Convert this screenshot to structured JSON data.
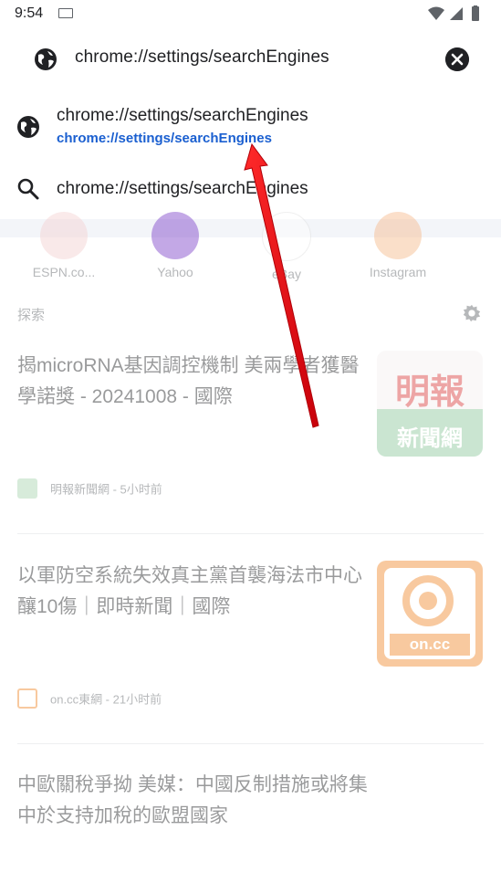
{
  "status_bar": {
    "time": "9:54"
  },
  "omnibox": {
    "text": "chrome://settings/searchEngines"
  },
  "suggestions": [
    {
      "title": "chrome://settings/searchEngines",
      "url": "chrome://settings/searchEngines",
      "icon": "globe-icon"
    },
    {
      "title": "chrome://settings/searchEngines",
      "icon": "search-icon"
    }
  ],
  "tiles": [
    {
      "label": "ESPN.co...",
      "color": "#e53935"
    },
    {
      "label": "Yahoo",
      "color": "#7b3fc8"
    },
    {
      "label": "eBay",
      "color": "#e0e0e0"
    },
    {
      "label": "Instagram",
      "color": "#f56040"
    }
  ],
  "feed": {
    "section_title": "探索",
    "articles": [
      {
        "title": "揭microRNA基因調控機制 美兩學者獲醫學諾獎 - 20241008 - 國際",
        "source": "明報新聞網 - 5小时前",
        "thumb_text_top": "明報",
        "thumb_text_bottom": "新聞網"
      },
      {
        "title": "以軍防空系統失效真主黨首襲海法市中心釀10傷｜即時新聞｜國際",
        "source": "on.cc東網 - 21小时前",
        "thumb_text": "on.cc"
      },
      {
        "title": "中歐關稅爭拗 美媒：中國反制措施或將集中於支持加稅的歐盟國家"
      }
    ]
  },
  "colors": {
    "accent_link": "#1a5fd0",
    "annotation_arrow": "#e8121a"
  }
}
